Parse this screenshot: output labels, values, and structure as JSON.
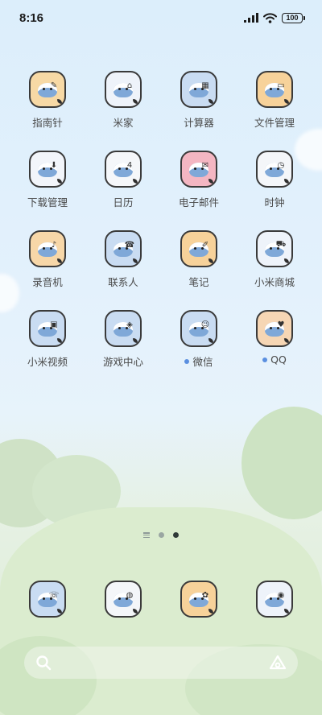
{
  "status_bar": {
    "time": "8:16",
    "battery": "100"
  },
  "apps": [
    {
      "label": "指南针",
      "tile": "#f7d9a5",
      "prop": "✎",
      "dot": false
    },
    {
      "label": "米家",
      "tile": "#eef3fa",
      "prop": "⌂",
      "dot": false
    },
    {
      "label": "计算器",
      "tile": "#c9dcf2",
      "prop": "▦",
      "dot": false
    },
    {
      "label": "文件管理",
      "tile": "#f7d29a",
      "prop": "▭",
      "dot": false
    },
    {
      "label": "下载管理",
      "tile": "#f2f5fa",
      "prop": "⬇",
      "dot": false
    },
    {
      "label": "日历",
      "tile": "#f5f7fa",
      "prop": "4",
      "dot": false
    },
    {
      "label": "电子邮件",
      "tile": "#f4b6c2",
      "prop": "✉",
      "dot": false
    },
    {
      "label": "时钟",
      "tile": "#f4f6f9",
      "prop": "◷",
      "dot": false
    },
    {
      "label": "录音机",
      "tile": "#f7d7a8",
      "prop": "♪",
      "dot": false
    },
    {
      "label": "联系人",
      "tile": "#c9dcf2",
      "prop": "☎",
      "dot": false
    },
    {
      "label": "笔记",
      "tile": "#f7d29a",
      "prop": "✐",
      "dot": false
    },
    {
      "label": "小米商城",
      "tile": "#eef3fa",
      "prop": "⛟",
      "dot": false
    },
    {
      "label": "小米视频",
      "tile": "#c9dcf2",
      "prop": "▣",
      "dot": false
    },
    {
      "label": "游戏中心",
      "tile": "#c9dcf2",
      "prop": "◈",
      "dot": false
    },
    {
      "label": "微信",
      "tile": "#c9dcf2",
      "prop": "☺",
      "dot": true
    },
    {
      "label": "QQ",
      "tile": "#f6d6b4",
      "prop": "♥",
      "dot": true
    }
  ],
  "dock": [
    {
      "tile": "#c9dcf2",
      "prop": "☏"
    },
    {
      "tile": "#f4f6f9",
      "prop": "◍"
    },
    {
      "tile": "#f7d29a",
      "prop": "✿"
    },
    {
      "tile": "#eef3fa",
      "prop": "◉"
    }
  ]
}
